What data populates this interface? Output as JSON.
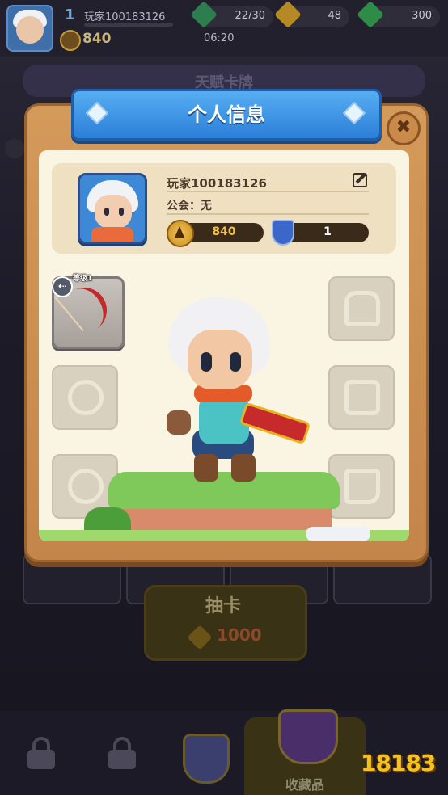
{
  "top_bar": {
    "level": "1",
    "player_name": "玩家100183126",
    "score": "840",
    "energy": "22/30",
    "gold": "48",
    "gems": "300",
    "timer": "06:20"
  },
  "background": {
    "section_title": "天赋卡牌",
    "draw_button": {
      "label": "抽卡",
      "cost": "1000"
    },
    "bottom_nav": {
      "active_label": "收藏品"
    },
    "watermark": "18183"
  },
  "dialog": {
    "title": "个人信息",
    "close_symbol": "✖",
    "player_name": "玩家100183126",
    "guild": "公会：无",
    "score": "840",
    "rank": "1",
    "weapon_level": "等级1",
    "back_symbol": "⇠"
  },
  "icons": {
    "energy": "lightning-icon",
    "gold": "gold-coin-icon",
    "gems": "gem-icon",
    "edit": "edit-icon",
    "score": "trophy-badge-icon",
    "rank": "shield-icon"
  },
  "colors": {
    "dialog_frame": "#d49a5a",
    "title_banner": "#2c7fd8",
    "panel_bg": "#faf4e2",
    "score_text": "#f3c44a"
  }
}
